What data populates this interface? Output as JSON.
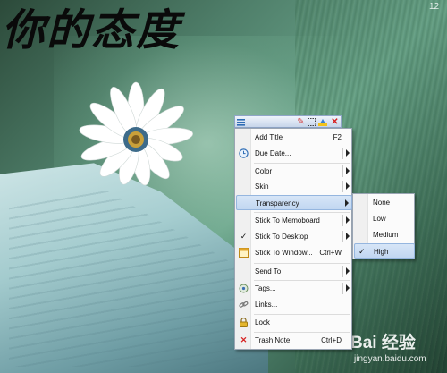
{
  "wallpaper": {
    "title_text": "你的态度",
    "corner_text": "12",
    "watermark_brand": "Bai 经验",
    "watermark_url": "jingyan.baidu.com"
  },
  "note_bar": {
    "icons": [
      "note-menu-icon",
      "pin-icon",
      "selection-icon",
      "highlight-icon",
      "close-icon"
    ]
  },
  "context_menu": {
    "items": [
      {
        "label": "Add Title",
        "shortcut": "F2"
      },
      {
        "label": "Due Date...",
        "icon": "clock-icon"
      },
      {
        "label": "Color"
      },
      {
        "label": "Skin"
      },
      {
        "label": "Transparency"
      },
      {
        "label": "Stick To Memoboard"
      },
      {
        "label": "Stick To Desktop",
        "checked": "✓"
      },
      {
        "label": "Stick To Window...",
        "shortcut": "Ctrl+W",
        "icon": "window-icon"
      },
      {
        "label": "Send To"
      },
      {
        "label": "Tags...",
        "icon": "tag-icon"
      },
      {
        "label": "Links...",
        "icon": "link-icon"
      },
      {
        "label": "Lock",
        "icon": "lock-icon"
      },
      {
        "label": "Trash Note",
        "shortcut": "Ctrl+D",
        "icon": "trash-icon"
      }
    ]
  },
  "transparency_submenu": {
    "items": [
      {
        "label": "None"
      },
      {
        "label": "Low"
      },
      {
        "label": "Medium"
      },
      {
        "label": "High",
        "checked": "✓"
      }
    ]
  },
  "colors": {
    "highlight": "#c1d7f1",
    "menu_bg": "#fbfbfb",
    "trash_red": "#d62020"
  }
}
